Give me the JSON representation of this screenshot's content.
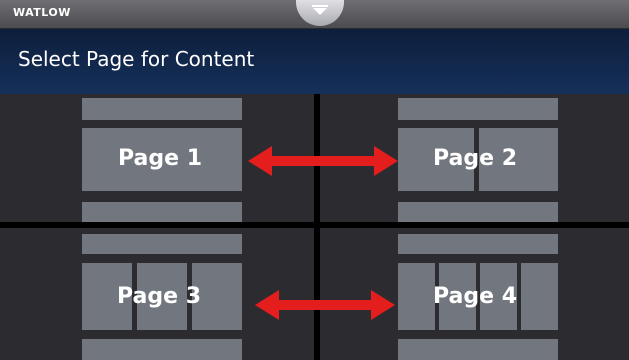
{
  "topbar": {
    "brand": "WATLOW",
    "pulltab_icon": "chevron-down-icon"
  },
  "header": {
    "title": "Select Page for Content"
  },
  "pages": [
    {
      "label": "Page 1",
      "layout": "single"
    },
    {
      "label": "Page 2",
      "layout": "two-column"
    },
    {
      "label": "Page 3",
      "layout": "three-column"
    },
    {
      "label": "Page 4",
      "layout": "four-column"
    }
  ],
  "arrow_color": "#e41d1d"
}
